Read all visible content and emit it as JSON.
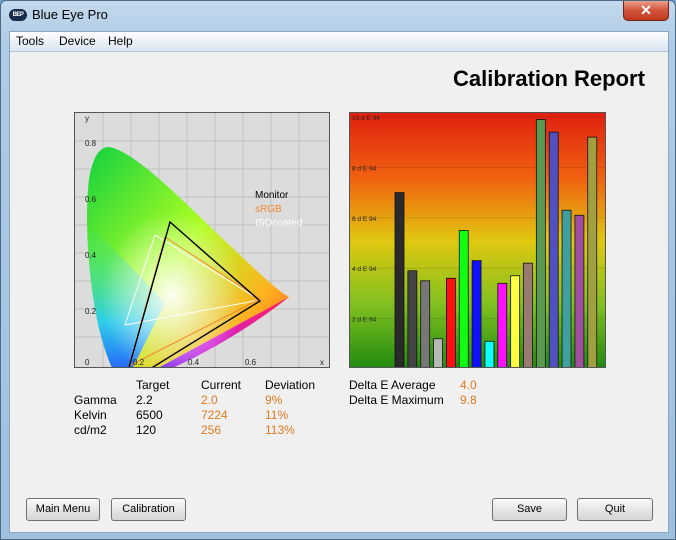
{
  "window": {
    "title": "Blue Eye Pro",
    "icon_text": "BEP",
    "close_label": "✕"
  },
  "menu": {
    "items": [
      "Tools",
      "Device",
      "Help"
    ]
  },
  "report": {
    "title": "Calibration Report"
  },
  "chromaticity": {
    "axis_x_label": "x",
    "axis_y_label": "y",
    "x_ticks": [
      "0.2",
      "0.4",
      "0.6"
    ],
    "y_ticks": [
      "0.8",
      "0.6",
      "0.4",
      "0.2",
      "0"
    ],
    "legend": [
      {
        "label": "Monitor",
        "color": "#000000"
      },
      {
        "label": "sRGB",
        "color": "#f08a30"
      },
      {
        "label": "ISOcoated",
        "color": "#ffffff"
      }
    ]
  },
  "chart_data": {
    "type": "bar",
    "title": "",
    "ylabel": "",
    "ylim": [
      0,
      10
    ],
    "y_ticks": [
      "10 d E 94",
      "8 d E 94",
      "6 d E 94",
      "4 d E 94",
      "2 d E 94"
    ],
    "values": [
      7.0,
      3.9,
      3.5,
      1.2,
      3.6,
      5.5,
      4.3,
      1.1,
      3.4,
      3.7,
      4.2,
      9.9,
      9.4,
      6.3,
      6.1,
      9.2
    ],
    "colors": [
      "#2a2a2a",
      "#444444",
      "#777777",
      "#b8b8b8",
      "#ff1010",
      "#10ff10",
      "#1010ff",
      "#10ffff",
      "#ff10ff",
      "#ffff40",
      "#9a7a70",
      "#5a9a50",
      "#5050c0",
      "#40a0a0",
      "#a050a0",
      "#a0a040"
    ]
  },
  "stats": {
    "headers": [
      "Target",
      "Current",
      "Deviation"
    ],
    "rows": [
      {
        "label": "Gamma",
        "target": "2.2",
        "current": "2.0",
        "deviation": "9%"
      },
      {
        "label": "Kelvin",
        "target": "6500",
        "current": "7224",
        "deviation": "11%"
      },
      {
        "label": "cd/m2",
        "target": "120",
        "current": "256",
        "deviation": "113%"
      }
    ]
  },
  "delta_e": {
    "average_label": "Delta E Average",
    "average_value": "4.0",
    "maximum_label": "Delta E Maximum",
    "maximum_value": "9.8"
  },
  "buttons": {
    "main_menu": "Main Menu",
    "calibration": "Calibration",
    "save": "Save",
    "quit": "Quit"
  }
}
